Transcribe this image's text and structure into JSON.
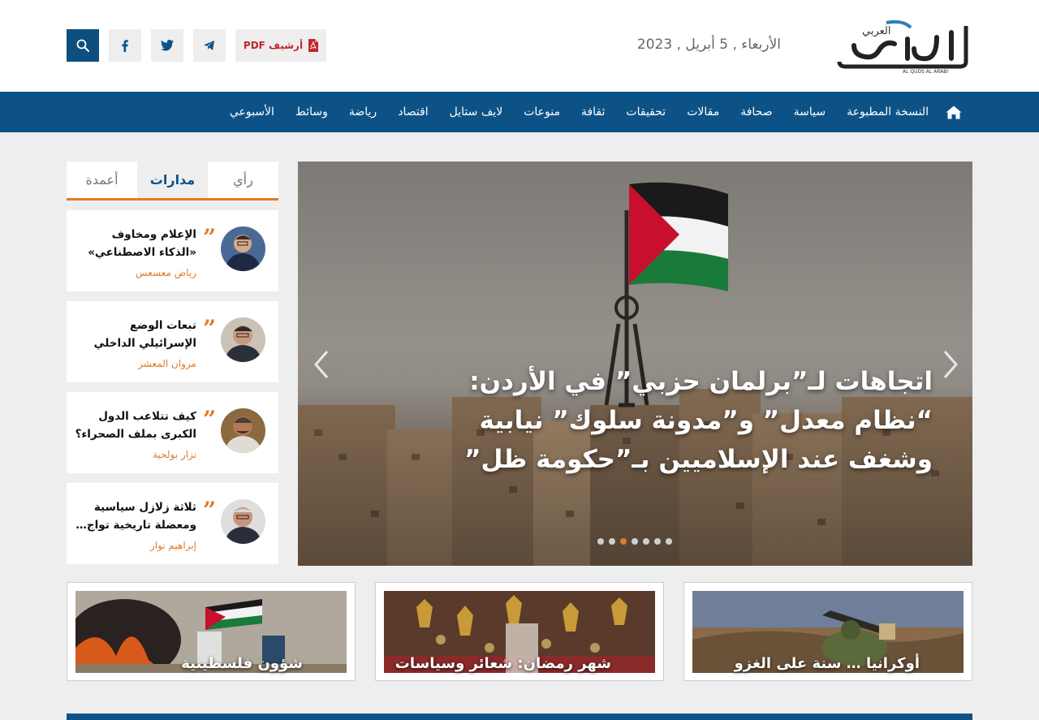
{
  "header": {
    "logo_text": "القدس العربي",
    "logo_subtext": "AL QUDS AL ARABI",
    "date": "الأربعاء , 5 أبريل , 2023",
    "pdf_archive_label": "أرشيف PDF",
    "social": [
      "telegram-icon",
      "twitter-icon",
      "facebook-icon",
      "search-icon"
    ]
  },
  "nav": {
    "items": [
      "النسخة المطبوعة",
      "سياسة",
      "صحافة",
      "مقالات",
      "تحقيقات",
      "ثقافة",
      "منوعات",
      "لايف ستايل",
      "اقتصاد",
      "رياضة",
      "وسائط",
      "الأسبوعي"
    ]
  },
  "sidebar": {
    "tabs": [
      "رأي",
      "مدارات",
      "أعمدة"
    ],
    "active_tab": "مدارات",
    "articles": [
      {
        "title": "الإعلام ومخاوف «الذكاء الاصطناعي»",
        "author": "رياض معسعس"
      },
      {
        "title": "تبعات الوضع الإسرائيلي الداخلي على الأردن…",
        "author": "مروان المعشر"
      },
      {
        "title": "كيف تتلاعب الدول الكبرى بملف الصحراء؟",
        "author": "نزار بولحية"
      },
      {
        "title": "ثلاثة زلازل سياسية ومعضلة تاريخية تواج…",
        "author": "إبراهيم نوار"
      }
    ]
  },
  "slider": {
    "headline": "اتجاهات لـ”برلمان حزبي” في الأردن: “نظام معدل” و”مدونة سلوك” نيابية وشغف عند الإسلاميين بـ”حكومة ظل”",
    "slide_count": 7,
    "active_slide": 3
  },
  "categories": [
    {
      "label": "أوكرانيا … سنة على الغزو"
    },
    {
      "label": "شهر رمضان: شعائر وسياسات"
    },
    {
      "label": "شؤون فلسطينية"
    }
  ],
  "colors": {
    "primary": "#0d5287",
    "accent": "#e07b2a",
    "pdf": "#c0272d"
  }
}
